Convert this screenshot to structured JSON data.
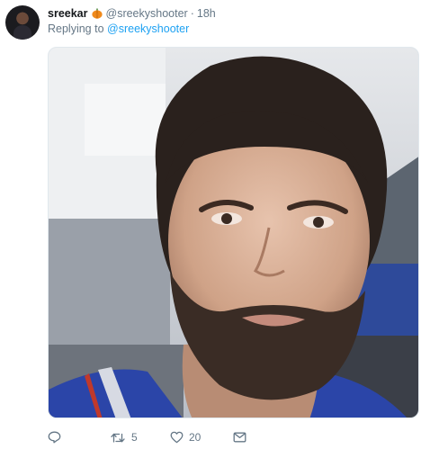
{
  "tweet": {
    "author_name": "sreekar",
    "author_handle": "@sreekyshooter",
    "separator": "·",
    "time": "18h",
    "reply_prefix": "Replying to",
    "reply_to": "@sreekyshooter",
    "icons": {
      "name_emoji": "pumpkin-icon",
      "reply": "reply-icon",
      "retweet": "retweet-icon",
      "like": "heart-icon",
      "message": "message-icon"
    }
  },
  "actions": {
    "retweet_count": "5",
    "like_count": "20"
  },
  "colors": {
    "link": "#1da1f2",
    "muted": "#657786",
    "text": "#14171a"
  }
}
